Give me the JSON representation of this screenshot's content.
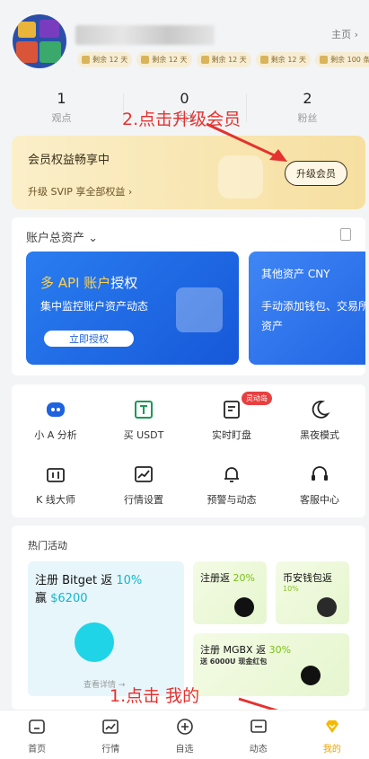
{
  "header": {
    "homepage_label": "主页",
    "badges": [
      {
        "icon": "fan-icon",
        "text": "剩余 12 天"
      },
      {
        "icon": "home-icon",
        "text": "剩余 12 天"
      },
      {
        "icon": "coin-icon",
        "text": "剩余 12 天"
      },
      {
        "icon": "phone-icon",
        "text": "剩余 12 天"
      },
      {
        "icon": "ticket-icon",
        "text": "剩余 100 条"
      }
    ]
  },
  "stats": [
    {
      "value": "1",
      "label": "观点"
    },
    {
      "value": "0",
      "label": "关注"
    },
    {
      "value": "2",
      "label": "粉丝"
    }
  ],
  "member": {
    "title": "会员权益畅享中",
    "subtitle": "升级 SVIP 享全部权益 ›",
    "button": "升级会员"
  },
  "assets": {
    "header": "账户总资产 ⌄",
    "api_card": {
      "title_highlight": "多 API 账户",
      "title_rest": "授权",
      "desc": "集中监控账户资产动态",
      "button": "立即授权"
    },
    "other_card": {
      "title": "其他资产 CNY",
      "desc": "手动添加钱包、交易所资产"
    }
  },
  "tools": [
    {
      "icon": "robot-icon",
      "label": "小 A 分析"
    },
    {
      "icon": "usdt-icon",
      "label": "买 USDT"
    },
    {
      "icon": "monitor-icon",
      "label": "实时盯盘",
      "tag": "灵动岛"
    },
    {
      "icon": "moon-icon",
      "label": "黑夜模式"
    },
    {
      "icon": "kline-icon",
      "label": "K 线大师"
    },
    {
      "icon": "chart-icon",
      "label": "行情设置"
    },
    {
      "icon": "bell-icon",
      "label": "预警与动态"
    },
    {
      "icon": "headset-icon",
      "label": "客服中心"
    }
  ],
  "activities": {
    "header": "热门活动",
    "bitget": {
      "line1_a": "注册 Bitget 返 ",
      "line1_b": "10%",
      "line2_a": "赢 ",
      "line2_b": "$6200",
      "more": "查看详情 →"
    },
    "card1": {
      "a": "注册返 ",
      "b": "20%"
    },
    "card2": {
      "a": "币安钱包返",
      "b": "10%"
    },
    "card3": {
      "a": "注册 MGBX 返 ",
      "b": "30%",
      "sub": "送 6000U 现金红包"
    }
  },
  "annotations": {
    "step2": "2.点击升级会员",
    "step1": "1.点击 我的"
  },
  "tabbar": [
    {
      "icon": "home-tab-icon",
      "label": "首页"
    },
    {
      "icon": "market-tab-icon",
      "label": "行情"
    },
    {
      "icon": "plus-tab-icon",
      "label": "自选"
    },
    {
      "icon": "message-tab-icon",
      "label": "动态"
    },
    {
      "icon": "diamond-tab-icon",
      "label": "我的"
    }
  ],
  "colors": {
    "accent_gold": "#e8a300",
    "annotation_red": "#e5312f",
    "brand_blue": "#1e62df"
  }
}
